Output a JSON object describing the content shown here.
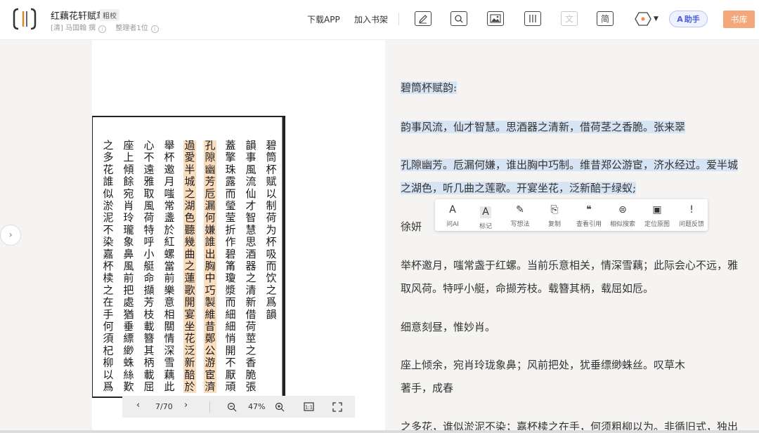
{
  "header": {
    "book_title": "红藕花轩赋草",
    "edition_tag": "粗校",
    "author": "[清] 马国翰 撰",
    "contributors": "整理者1位",
    "download_app": "下载APP",
    "add_shelf": "加入书架",
    "tools": [
      {
        "name": "annotate",
        "icon": "pen-icon"
      },
      {
        "name": "search",
        "icon": "search-icon"
      },
      {
        "name": "image",
        "icon": "image-icon"
      },
      {
        "name": "columns",
        "icon": "columns-icon"
      },
      {
        "name": "translate",
        "label": "文"
      },
      {
        "name": "simplified",
        "label": "简"
      }
    ],
    "assistant": "助手",
    "library": "书库"
  },
  "pager": {
    "page": "7/70",
    "zoom": "47%"
  },
  "text": {
    "p1": "碧筒杯赋韵:",
    "p2": "韵事风流，仙才智慧。思酒器之清新，借荷茎之香脆。张来翠",
    "p3a": "孔隙幽芳。卮漏何嫌，谁出胸中巧制。维昔郑公游宦，济水经过。爱半城",
    "p3b": "之湖色，听几曲之莲歌。开宴坐花，泛新醅于绿蚁;",
    "p4": "徐妍",
    "p5a": "举杯邀月，嗤常盏于红螺。当前乐意相关，情深雪藕；此际会心不远，雅",
    "p5b": "取风荷。特呼小艇，命撷芳枝。载簪其柄，载屈如卮。",
    "p6": "细意刻昼，惟妙肖。",
    "p7a": "座上倾余，宛肖玲珑象鼻；风前把处，犹垂缥缈蛛丝。叹草木",
    "p7b": "著手，成春",
    "p8": "之多花，谁似淤泥不染；嘉杯椟之在手，何须粗柳以为。非循旧式，独出"
  },
  "popup": [
    {
      "icon": "ask-ai-icon",
      "glyph": "A",
      "label": "问AI"
    },
    {
      "icon": "mark-icon",
      "glyph": "A",
      "label": "标记"
    },
    {
      "icon": "write-icon",
      "glyph": "✎",
      "label": "写想法"
    },
    {
      "icon": "copy-icon",
      "glyph": "⎘",
      "label": "复制"
    },
    {
      "icon": "quote-icon",
      "glyph": "❝",
      "label": "查看引用"
    },
    {
      "icon": "similar-search-icon",
      "glyph": "⊜",
      "label": "相似搜索"
    },
    {
      "icon": "locate-image-icon",
      "glyph": "▣",
      "label": "定位原图"
    },
    {
      "icon": "feedback-icon",
      "glyph": "!",
      "label": "问题反馈"
    }
  ],
  "scan_columns": [
    "碧筒杯赋以制荷为杯吸而饮之爲韻",
    "韻事風流仙才智慧思酒器之清新借荷莖之香脆張來翠",
    "蓋擎珠露而瑩莹折作碧筩瓊漿而細細悄開不厭頑爪",
    "孔隙幽芳卮漏何嫌誰出胸中巧製維昔鄭公游宦濟水經",
    "過愛半城之湖色聽幾曲之蓮歌開宴坐花泛新醅於綠蟻",
    "舉杯邀月嗤常盞於紅螺當前樂意相關情深雪藕此際會",
    "心不遠雅取風荷特呼小艇命擷芳枝載簪其柄載屈如卮",
    "座上傾餘宛肖玲瓏象鼻風前把處猶垂縹緲蛛絲歎草木",
    "之多花誰似淤泥不染嘉杯椟之在手何須杞柳以爲非循"
  ]
}
